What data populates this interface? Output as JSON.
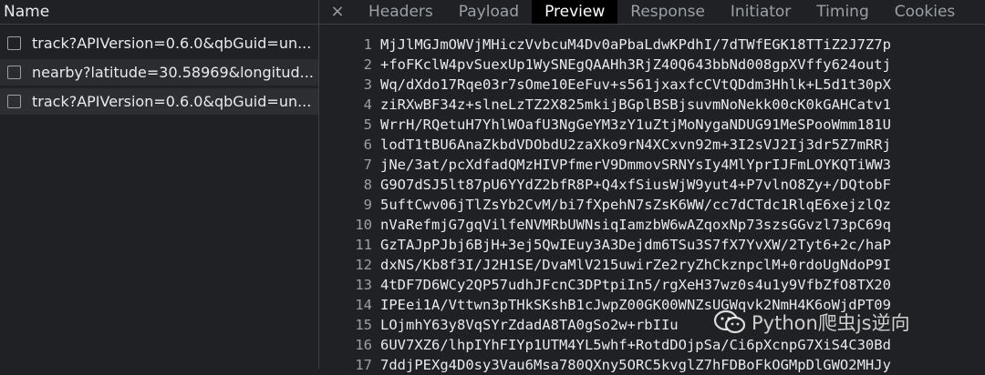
{
  "left": {
    "header": "Name",
    "requests": [
      {
        "name": "track?APIVersion=0.6.0&qbGuid=un..."
      },
      {
        "name": "nearby?latitude=30.58969&longitud..."
      },
      {
        "name": "track?APIVersion=0.6.0&qbGuid=un..."
      }
    ]
  },
  "tabs": {
    "close": "×",
    "items": [
      "Headers",
      "Payload",
      "Preview",
      "Response",
      "Initiator",
      "Timing",
      "Cookies"
    ],
    "active": "Preview"
  },
  "code": [
    {
      "n": "1",
      "t": "MjJlMGJmOWVjMHiczVvbcuM4Dv0aPbaLdwKPdhI/7dTWfEGK18TTiZ2J7Z7p"
    },
    {
      "n": "2",
      "t": "+foFKclW4pvSuexUp1WySNEgQAAHh3RjZ40Q643bbNd008gpXVffy624outj"
    },
    {
      "n": "3",
      "t": "Wq/dXdo17Rqe03r7sOme10EeFuv+s561jxaxfcCVtQDdm3Hhlk+L5d1t30pX"
    },
    {
      "n": "4",
      "t": "ziRXwBF34z+slneLzTZ2X825mkijBGplBSBjsuvmNoNekk00cK0kGAHCatv1"
    },
    {
      "n": "5",
      "t": "WrrH/RQetuH7YhlWOafU3NgGeYM3zY1uZtjMoNygaNDUG91MeSPooWmm181U"
    },
    {
      "n": "6",
      "t": "lodT1tBU6AnaZkbdVDObdU2zaXko9rN4XCxvn92m+3I2sVJ2Ij3dr5Z7mRRj"
    },
    {
      "n": "7",
      "t": "jNe/3at/pcXdfadQMzHIVPfmerV9DmmovSRNYsIy4MlYprIJFmLOYKQTiWW3"
    },
    {
      "n": "8",
      "t": "G9O7dSJ5lt87pU6YYdZ2bfR8P+Q4xfSiusWjW9yut4+P7vlnO8Zy+/DQtobF"
    },
    {
      "n": "9",
      "t": "5uftCwv06jTlZsYb2CvM/bi7fXpehN7sZsK6WW/cc7dCTdc1RlqE6xejzlQz"
    },
    {
      "n": "10",
      "t": "nVaRefmjG7gqVilfeNVMRbUWNsiqIamzbW6wAZqoxNp73szsGGvzl73pC69q"
    },
    {
      "n": "11",
      "t": "GzTAJpPJbj6BjH+3ej5QwIEuy3A3Dejdm6TSu3S7fX7YvXW/2Tyt6+2c/haP"
    },
    {
      "n": "12",
      "t": "dxNS/Kb8f3I/J2H1SE/DvaMlV215uwirZe2ryZhCkznpclM+0rdoUgNdoP9I"
    },
    {
      "n": "13",
      "t": "4tDF7D6WCy2QP57udhJFcnC3DPtpiIn5/rgXeH37wz0s4u1y9VfbZfO8TX20"
    },
    {
      "n": "14",
      "t": "IPEei1A/Vttwn3pTHkSKshB1cJwpZ00GK00WNZsUGWqvk2NmH4K6oWjdPT09"
    },
    {
      "n": "15",
      "t": "LOjmhY63y8VqSYrZdadA8TA0gSo2w+rbIIu"
    },
    {
      "n": "16",
      "t": "6UV7XZ6/lhpIYhFIYp1UTM4YL5whf+RotdDOjpSa/Ci6pXcnpG7XiS4C30Bd"
    },
    {
      "n": "17",
      "t": "7ddjPEXg4D0sy3Vau6Msa780QXny5ORC5kvglZ7hFDBoFkOGMpDlGWO2MHJy"
    }
  ],
  "watermark": {
    "text": "Python爬虫js逆向",
    "icon": "wechat-icon"
  }
}
